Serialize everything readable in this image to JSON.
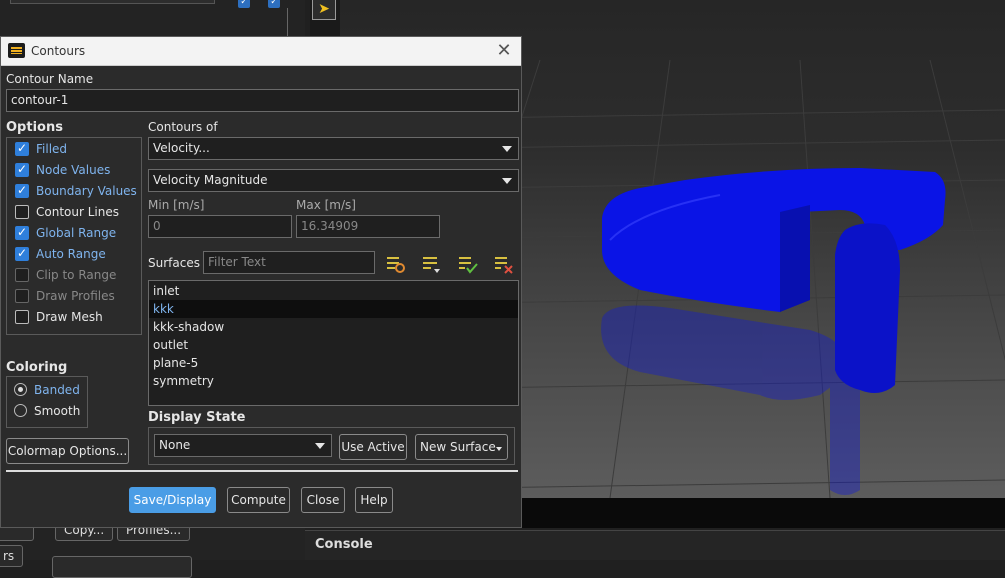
{
  "background": {
    "bg_buttons": [
      "Copy...",
      "Profiles...",
      "rs"
    ],
    "console_title": "Console",
    "accent": "#2f7fdb",
    "model_color": "#0a14e6"
  },
  "dialog": {
    "title": "Contours",
    "contour_name_label": "Contour Name",
    "contour_name_value": "contour-1",
    "options_label": "Options",
    "options": [
      {
        "label": "Filled",
        "checked": true,
        "enabled": true
      },
      {
        "label": "Node Values",
        "checked": true,
        "enabled": true
      },
      {
        "label": "Boundary Values",
        "checked": true,
        "enabled": true
      },
      {
        "label": "Contour Lines",
        "checked": false,
        "enabled": true
      },
      {
        "label": "Global Range",
        "checked": true,
        "enabled": true
      },
      {
        "label": "Auto Range",
        "checked": true,
        "enabled": true
      },
      {
        "label": "Clip to Range",
        "checked": false,
        "enabled": false
      },
      {
        "label": "Draw Profiles",
        "checked": false,
        "enabled": false
      },
      {
        "label": "Draw Mesh",
        "checked": false,
        "enabled": true
      }
    ],
    "coloring_label": "Coloring",
    "coloring_options": [
      {
        "label": "Banded",
        "selected": true
      },
      {
        "label": "Smooth",
        "selected": false
      }
    ],
    "colormap_button": "Colormap Options...",
    "contours_of_label": "Contours of",
    "contours_of_value": "Velocity...",
    "contours_sub_value": "Velocity Magnitude",
    "min_label": "Min [m/s]",
    "min_value": "0",
    "max_label": "Max [m/s]",
    "max_value": "16.34909",
    "surfaces_label": "Surfaces",
    "filter_placeholder": "Filter Text",
    "surfaces": [
      "inlet",
      "kkk",
      "kkk-shadow",
      "outlet",
      "plane-5",
      "symmetry"
    ],
    "selected_surface": "kkk",
    "display_state_label": "Display State",
    "display_state_value": "None",
    "use_active_button": "Use Active",
    "new_surface_button": "New Surface",
    "footer_buttons": {
      "save_display": "Save/Display",
      "compute": "Compute",
      "close": "Close",
      "help": "Help"
    }
  }
}
